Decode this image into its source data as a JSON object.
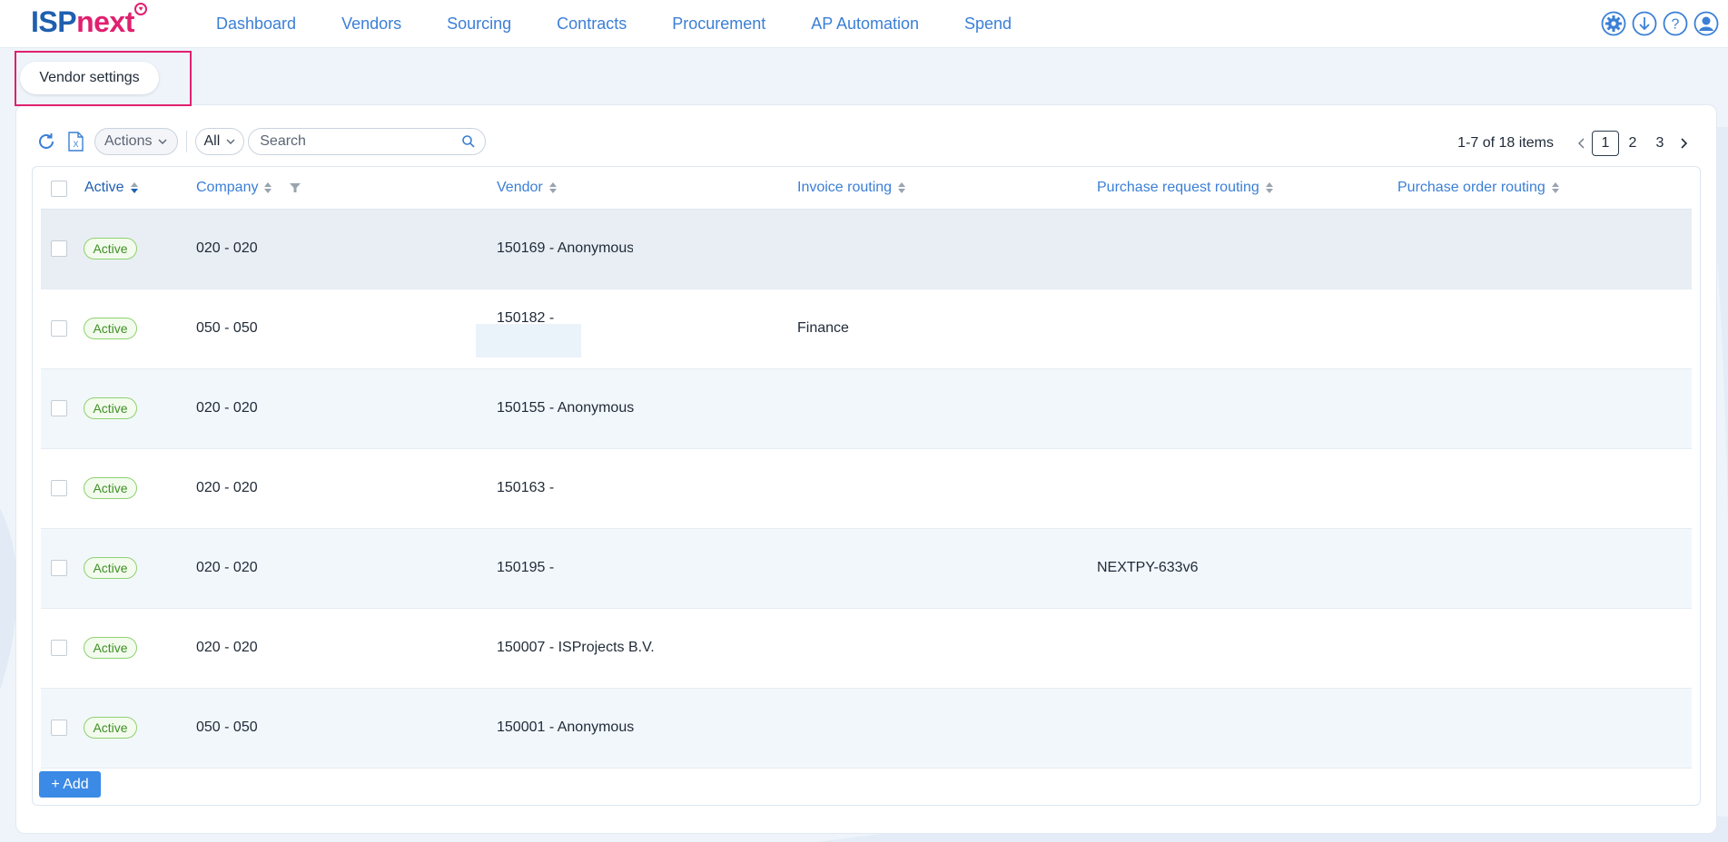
{
  "brand": {
    "part1": "ISP",
    "part2": "next"
  },
  "nav": [
    "Dashboard",
    "Vendors",
    "Sourcing",
    "Contracts",
    "Procurement",
    "AP Automation",
    "Spend"
  ],
  "top_icons": [
    "settings-icon",
    "download-icon",
    "help-icon",
    "user-icon"
  ],
  "page_tab": "Vendor settings",
  "toolbar": {
    "actions_label": "Actions",
    "filter_value": "All",
    "search_placeholder": "Search"
  },
  "pagination": {
    "info": "1-7 of 18 items",
    "pages": [
      "1",
      "2",
      "3"
    ],
    "current": "1"
  },
  "table": {
    "columns": [
      "Active",
      "Company",
      "Vendor",
      "Invoice routing",
      "Purchase request routing",
      "Purchase order routing"
    ],
    "rows": [
      {
        "active": "Active",
        "company": "020 - 020",
        "vendor": "150169 - Anonymous",
        "invoice": "",
        "pr": "",
        "po": ""
      },
      {
        "active": "Active",
        "company": "050 - 050",
        "vendor": "150182 -",
        "invoice": "Finance",
        "pr": "",
        "po": ""
      },
      {
        "active": "Active",
        "company": "020 - 020",
        "vendor": "150155 - Anonymous",
        "invoice": "",
        "pr": "",
        "po": ""
      },
      {
        "active": "Active",
        "company": "020 - 020",
        "vendor": "150163 -",
        "invoice": "",
        "pr": "",
        "po": ""
      },
      {
        "active": "Active",
        "company": "020 - 020",
        "vendor": "150195 -",
        "invoice": "",
        "pr": "NEXTPY-633v6",
        "po": ""
      },
      {
        "active": "Active",
        "company": "020 - 020",
        "vendor": "150007 - ISProjects B.V.",
        "invoice": "",
        "pr": "",
        "po": ""
      },
      {
        "active": "Active",
        "company": "050 - 050",
        "vendor": "150001 - Anonymous",
        "invoice": "",
        "pr": "",
        "po": ""
      }
    ]
  },
  "add_button": "+ Add",
  "colors": {
    "accent": "#3b7fd6",
    "brand_pink": "#e0206f",
    "brand_blue": "#1f5fb0",
    "badge_green": "#3f8f25"
  }
}
